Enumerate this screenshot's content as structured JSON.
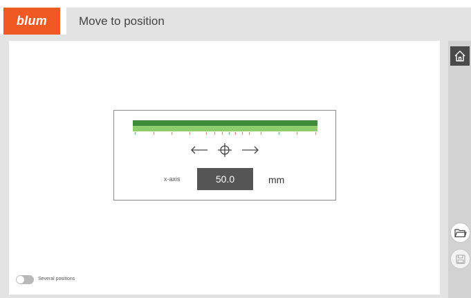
{
  "header": {
    "logo_text": "blum",
    "title": "Move to position"
  },
  "colors": {
    "brand": "#f05a22",
    "ruler_dark": "#3c8a3a",
    "ruler_light": "#8ccd6c",
    "value_box": "#555555"
  },
  "sidebar": {
    "icons": [
      "home-icon",
      "open-folder-icon",
      "save-icon"
    ]
  },
  "position": {
    "axis_label": "x-axis",
    "value": "50.0",
    "unit": "mm",
    "arrows": [
      "arrow-left-icon",
      "crosshair-icon",
      "arrow-right-icon"
    ]
  },
  "options": {
    "several_positions_label": "Several positions",
    "several_positions_on": false
  }
}
